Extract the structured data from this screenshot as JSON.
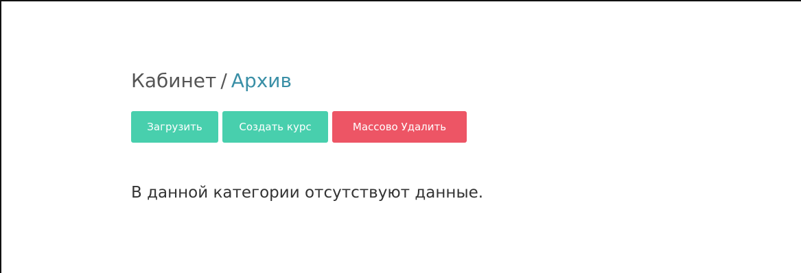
{
  "breadcrumb": {
    "parent": "Кабинет",
    "separator": "/",
    "current": "Архив"
  },
  "actions": {
    "upload_label": "Загрузить",
    "create_course_label": "Создать курс",
    "bulk_delete_label": "Массово Удалить"
  },
  "messages": {
    "empty": "В данной категории отсутствуют данные."
  },
  "colors": {
    "primary": "#48cfad",
    "danger": "#ed5565",
    "link": "#3a8fa6"
  }
}
